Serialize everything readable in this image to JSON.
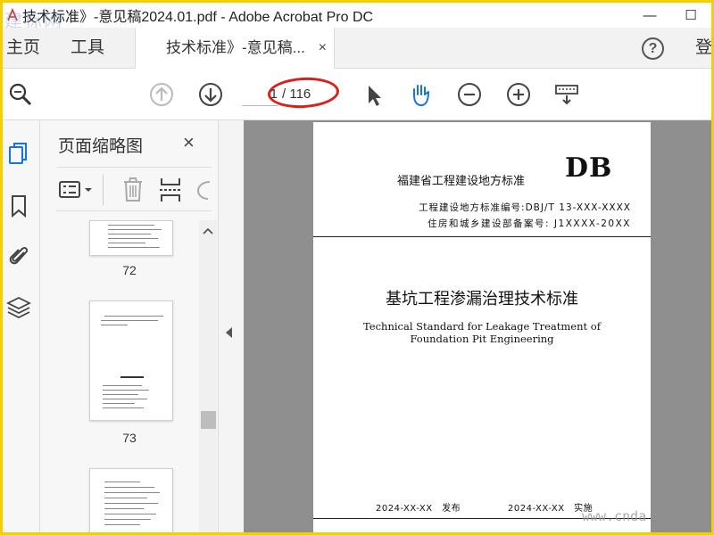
{
  "window": {
    "title": "技术标准》-意见稿2024.01.pdf - Adobe Acrobat Pro DC",
    "minimize_glyph": "—",
    "restore_glyph": "☐",
    "watermark": "建标网"
  },
  "menubar": {
    "home": "主页",
    "tools": "工具",
    "tab_label": "技术标准》-意见稿...",
    "tab_close": "×",
    "help": "?",
    "signin": "登"
  },
  "toolbar": {
    "page_current": "1",
    "page_total": "/ 116",
    "icons": [
      "search-zoom-icon",
      "arrow-up-icon",
      "arrow-down-icon",
      "select-cursor-icon",
      "hand-tool-icon",
      "zoom-out-icon",
      "zoom-in-icon",
      "keyboard-icon"
    ]
  },
  "rail": {
    "icons": [
      "page-thumbnails-icon",
      "bookmark-icon",
      "attachment-icon",
      "layers-icon"
    ]
  },
  "panel": {
    "title": "页面缩略图",
    "close": "×",
    "thumbnails": [
      {
        "label": "72"
      },
      {
        "label": "73"
      }
    ]
  },
  "page": {
    "issuer": "福建省工程建设地方标准",
    "db": "DB",
    "std_no": "工程建设地方标准编号:DBJ/T 13-XXX-XXXX",
    "record_no": "住房和城乡建设部备案号: J1XXXX-20XX",
    "title_cn": "基坑工程渗漏治理技术标准",
    "title_en_1": "Technical Standard for Leakage Treatment of",
    "title_en_2": "Foundation Pit Engineering",
    "publish_date": "2024-XX-XX　发布",
    "implement_date": "2024-XX-XX　实施"
  },
  "watermark_br": "www.cnda"
}
